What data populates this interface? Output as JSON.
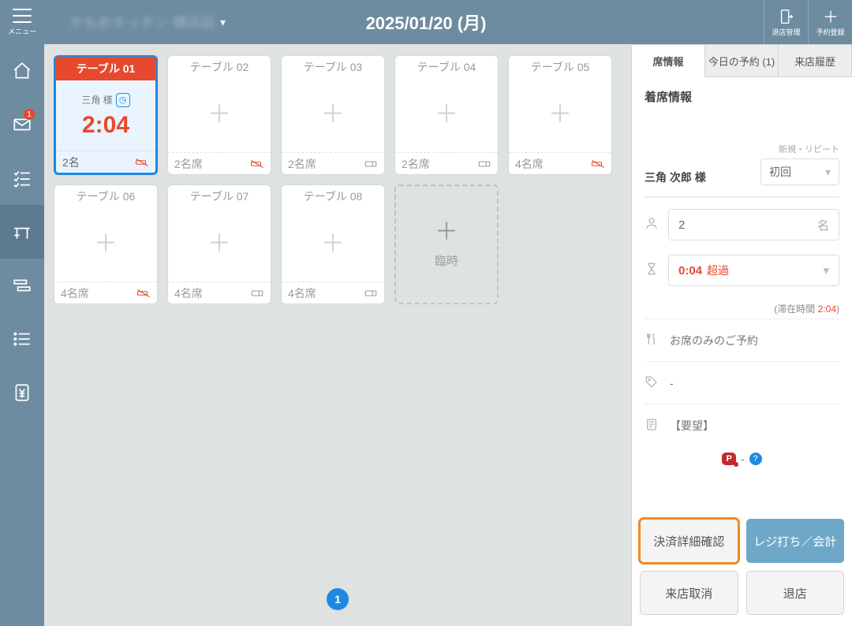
{
  "header": {
    "menu_label": "メニュー",
    "store_name": "かもめキッチン 横浜店",
    "date_title": "2025/01/20 (月)",
    "leave_mgmt_label": "退店管理",
    "add_resv_label": "予約登録"
  },
  "rail": {
    "msg_badge": "1"
  },
  "tables": [
    {
      "id": "t1",
      "name": "テーブル 01",
      "selected": true,
      "guest": "三角 様",
      "elapsed": "2:04",
      "footer": "2名",
      "footer_icon": "no-smoke"
    },
    {
      "id": "t2",
      "name": "テーブル 02",
      "footer": "2名席",
      "footer_icon": "no-smoke"
    },
    {
      "id": "t3",
      "name": "テーブル 03",
      "footer": "2名席",
      "footer_icon": "seat"
    },
    {
      "id": "t4",
      "name": "テーブル 04",
      "footer": "2名席",
      "footer_icon": "seat"
    },
    {
      "id": "t5",
      "name": "テーブル 05",
      "footer": "4名席",
      "footer_icon": "no-smoke"
    },
    {
      "id": "t6",
      "name": "テーブル 06",
      "footer": "4名席",
      "footer_icon": "no-smoke"
    },
    {
      "id": "t7",
      "name": "テーブル 07",
      "footer": "4名席",
      "footer_icon": "seat"
    },
    {
      "id": "t8",
      "name": "テーブル 08",
      "footer": "4名席",
      "footer_icon": "seat"
    }
  ],
  "temp_table_label": "臨時",
  "pager": {
    "current": "1"
  },
  "panel": {
    "tabs": {
      "seat": "席情報",
      "today": "今日の予約 (1)",
      "history": "来店履歴"
    },
    "title": "着席情報",
    "customer_name": "三角 次郎 様",
    "repeat_label": "新規・リピート",
    "repeat_value": "初回",
    "party_size": "2",
    "party_unit": "名",
    "time_value": "0:04",
    "time_over_label": "超過",
    "stay_prefix": "(滞在時間 ",
    "stay_time": "2:04",
    "stay_suffix": ")",
    "seat_only_label": "お席のみのご予約",
    "tag_value": "-",
    "request_label": "【要望】",
    "points_dash": "- ",
    "actions": {
      "pay_detail": "決済詳細確認",
      "register": "レジ打ち／会計",
      "cancel_visit": "来店取消",
      "leave": "退店"
    }
  }
}
